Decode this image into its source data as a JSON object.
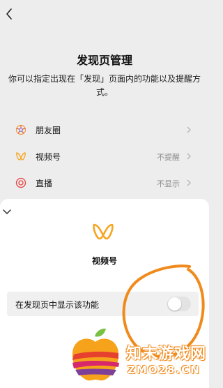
{
  "page": {
    "title": "发现页管理",
    "description": "你可以指定出现在「发现」页面内的功能以及提醒方式。"
  },
  "icons": {
    "back": "chevron-left-icon",
    "moments": "moments-aperture-icon",
    "channels": "channels-butterfly-icon",
    "live": "live-target-icon",
    "chevron": "chevron-right-icon",
    "close": "chevron-down-icon"
  },
  "list": [
    {
      "label": "朋友圈",
      "value": ""
    },
    {
      "label": "视频号",
      "value": "不提醒"
    },
    {
      "label": "直播",
      "value": "不显示"
    }
  ],
  "sheet": {
    "title": "视频号",
    "setting_label": "在发现页中显示该功能",
    "toggle_on": false
  },
  "watermark": {
    "text": "知末游戏网",
    "url": "ZMO28.CN"
  },
  "colors": {
    "background": "#ededed",
    "sheet": "#ffffff",
    "channels_orange": "#f5a623",
    "annotation_orange": "#f08a1c",
    "live_red": "#e64340"
  }
}
